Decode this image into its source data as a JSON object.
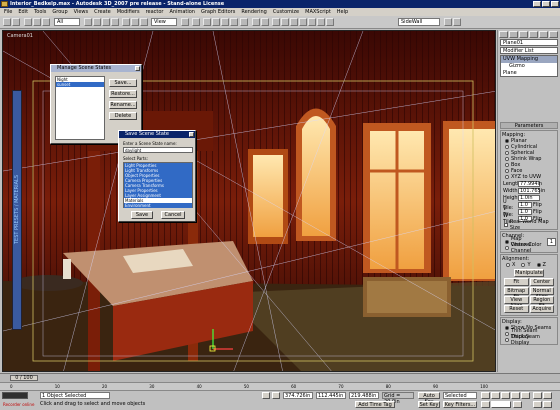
{
  "window": {
    "title": "Interior_Bedkelp.max - Autodesk 3D_2007 pre release - Stand-alone License"
  },
  "menu": [
    "File",
    "Edit",
    "Tools",
    "Group",
    "Views",
    "Create",
    "Modifiers",
    "reactor",
    "Animation",
    "Graph Editors",
    "Rendering",
    "Customize",
    "MAXScript",
    "Help"
  ],
  "toolbar": {
    "filter": "All",
    "refcoord": "View",
    "selset": "SideWall"
  },
  "viewport": {
    "label": "Camera01"
  },
  "left_panel": {
    "label": "TEST PRESETS / MATERIALS"
  },
  "manage_dialog": {
    "title": "Manage Scene States",
    "items": [
      "Night",
      "sunset"
    ],
    "buttons": {
      "save": "Save...",
      "restore": "Restore...",
      "rename": "Rename...",
      "delete": "Delete"
    }
  },
  "save_dialog": {
    "title": "Save Scene State",
    "prompt": "Enter a Scene State name:",
    "name_value": "daylight",
    "parts_label": "Select Parts:",
    "parts": [
      "Light Properties",
      "Light Transforms",
      "Object Properties",
      "Camera Properties",
      "Camera Transforms",
      "Layer Properties",
      "Layer Assignment",
      "Materials",
      "Environment"
    ],
    "save_label": "Save",
    "cancel_label": "Cancel"
  },
  "command_panel": {
    "object_name": "Plane01",
    "modifier_list": "Modifier List",
    "stack": [
      "UVW Mapping",
      "Gizmo",
      "Plane"
    ],
    "params_title": "Parameters",
    "mapping_label": "Mapping:",
    "mapping_options": [
      "Planar",
      "Cylindrical",
      "Spherical",
      "Shrink Wrap",
      "Box",
      "Face",
      "XYZ to UVW"
    ],
    "length_label": "Length:",
    "length_value": "77.994in",
    "width_label": "Width:",
    "width_value": "101.765in",
    "height_label": "Height:",
    "height_value": "1.0in",
    "utile_label": "U Tile:",
    "utile_value": "1.0",
    "vtile_label": "V Tile:",
    "vtile_value": "1.0",
    "wtile_label": "W Tile:",
    "wtile_value": "1.0",
    "flip_label": "Flip",
    "realworld_label": "Real-World Map Size",
    "channel_label": "Channel:",
    "mapchannel_label": "Map Channel:",
    "mapchannel_value": "1",
    "vertexcolor_label": "Vertex Color Channel",
    "alignment_label": "Alignment:",
    "axes": [
      "X",
      "Y",
      "Z"
    ],
    "manipulate_label": "Manipulate",
    "fit_label": "Fit",
    "center_label": "Center",
    "bitmapfit_label": "Bitmap Fit",
    "normalalign_label": "Normal Align",
    "viewalign_label": "View Align",
    "regionfit_label": "Region Fit",
    "reset_label": "Reset",
    "acquire_label": "Acquire",
    "display_label": "Display:",
    "display_options": [
      "Show No Seams",
      "Thin Seam Display",
      "Thick Seam Display"
    ]
  },
  "timeline": {
    "frame": "0 / 100",
    "ticks": [
      "0",
      "10",
      "20",
      "30",
      "40",
      "50",
      "60",
      "70",
      "80",
      "90",
      "100"
    ]
  },
  "status": {
    "selected": "1 Object Selected",
    "prompt": "Click and drag to select and move objects",
    "x_value": "374.726in",
    "y_value": "112.445in",
    "z_value": "219.488in",
    "grid": "Grid = 20.0in",
    "autokey": "Auto Key",
    "selected_dd": "Selected",
    "setkey": "Set Key",
    "keyfilters": "Key Filters...",
    "addtimetag": "Add Time Tag",
    "maxscript": "Recorder online"
  },
  "colors": {
    "dialog_blue": "#0a246a",
    "highlight": "#316ac5",
    "wood": "#6a1a08"
  }
}
